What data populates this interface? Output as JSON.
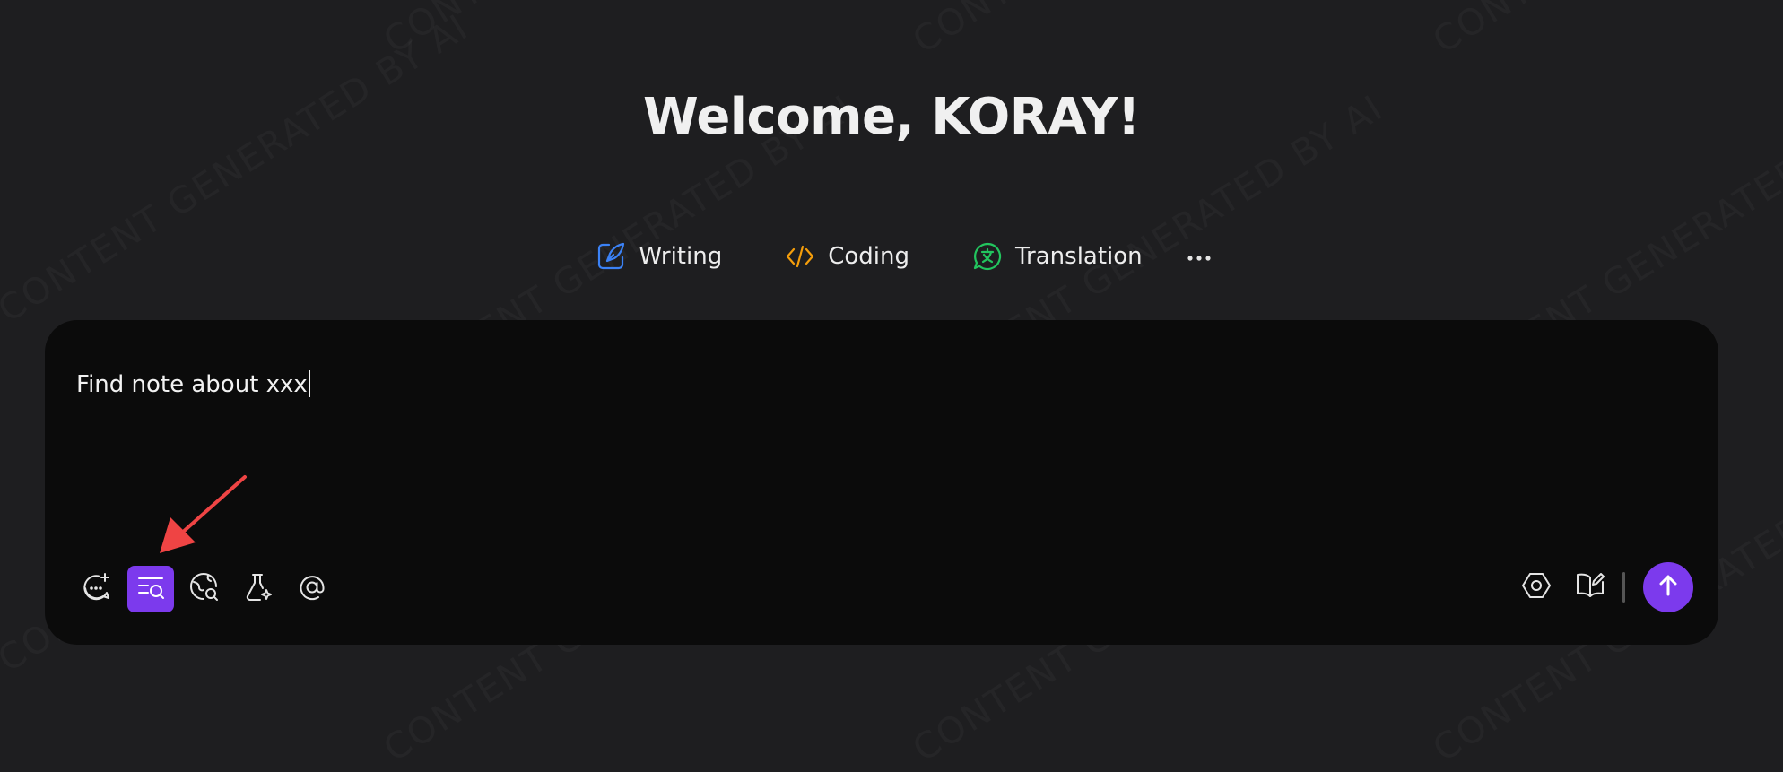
{
  "header": {
    "welcome": "Welcome, KORAY!"
  },
  "quick_actions": [
    {
      "label": "Writing",
      "icon": "feather-pen-icon",
      "color": "#3b82f6"
    },
    {
      "label": "Coding",
      "icon": "code-brackets-icon",
      "color": "#f59e0b"
    },
    {
      "label": "Translation",
      "icon": "translate-bubble-icon",
      "color": "#22c55e"
    }
  ],
  "more_icon": "ellipsis-icon",
  "input": {
    "value": "Find note about xxx"
  },
  "toolbar_left": [
    {
      "name": "new-chat",
      "icon": "chat-plus-icon",
      "active": false
    },
    {
      "name": "search-notes",
      "icon": "list-search-icon",
      "active": true
    },
    {
      "name": "web-search",
      "icon": "globe-search-icon",
      "active": false
    },
    {
      "name": "experiment",
      "icon": "flask-sparkle-icon",
      "active": false
    },
    {
      "name": "mention",
      "icon": "at-sign-icon",
      "active": false
    }
  ],
  "toolbar_right": [
    {
      "name": "model-settings",
      "icon": "hexagon-icon"
    },
    {
      "name": "knowledge-base",
      "icon": "book-edit-icon"
    }
  ],
  "send": {
    "icon": "arrow-up-icon"
  },
  "watermark": "CONTENT GENERATED BY AI",
  "colors": {
    "background": "#1e1e20",
    "panel": "#0b0b0b",
    "accent": "#7c3aed",
    "annotation": "#ef4444"
  }
}
